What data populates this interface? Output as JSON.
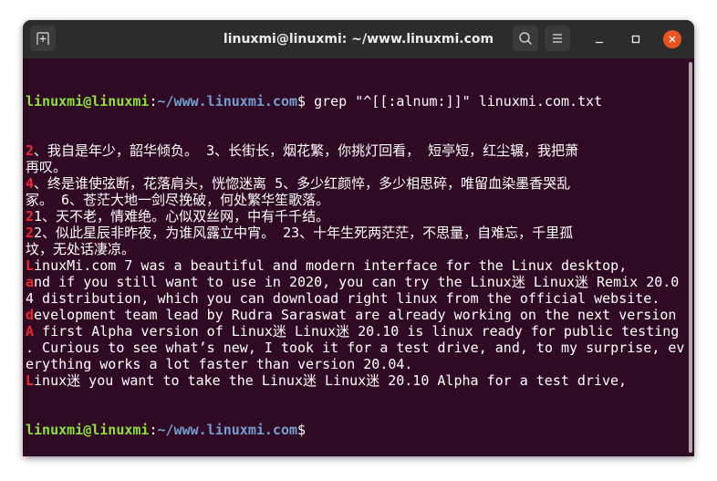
{
  "window": {
    "title": "linuxmi@linuxmi: ~/www.linuxmi.com"
  },
  "colors": {
    "background": "#300a24",
    "prompt_user": "#8ae234",
    "prompt_path": "#729fcf",
    "match": "#ef2929",
    "close": "#e95420"
  },
  "prompt": {
    "user": "linuxmi@linuxmi",
    "sep": ":",
    "path": "~/www.linuxmi.com",
    "dollar": "$"
  },
  "command": " grep \"^[[:alnum:]]\" linuxmi.com.txt",
  "output": [
    {
      "hl": "2",
      "text": "、我自是年少，韶华倾负。 3、长街长，烟花繁，你挑灯回看， 短亭短，红尘辗，我把萧"
    },
    {
      "hl": "",
      "text": "再叹。"
    },
    {
      "hl": "4",
      "text": "、终是谁使弦断，花落肩头，恍惚迷离 5、多少红颜悴，多少相思碎，唯留血染墨香哭乱"
    },
    {
      "hl": "",
      "text": "冢。 6、苍茫大地一剑尽挽破，何处繁华笙歌落。"
    },
    {
      "hl": "2",
      "text": "1、天不老，情难绝。心似双丝网，中有千千结。"
    },
    {
      "hl": "2",
      "text": "2、似此星辰非昨夜，为谁风露立中宵。 23、十年生死两茫茫，不思量，自难忘，千里孤"
    },
    {
      "hl": "",
      "text": "坟，无处话凄凉。"
    },
    {
      "hl": "L",
      "text": "inuxMi.com 7 was a beautiful and modern interface for the Linux desktop,"
    },
    {
      "hl": "a",
      "text": "nd if you still want to use in 2020, you can try the Linux迷 Linux迷 Remix 20.0"
    },
    {
      "hl": "",
      "text": "4 distribution, which you can download right linux from the official website."
    },
    {
      "hl": "d",
      "text": "evelopment team lead by Rudra Saraswat are already working on the next version"
    },
    {
      "hl": "A",
      "text": " first Alpha version of Linux迷 Linux迷 20.10 is linux ready for public testing"
    },
    {
      "hl": "",
      "text": ". Curious to see what’s new, I took it for a test drive, and, to my surprise, ev"
    },
    {
      "hl": "",
      "text": "erything works a lot faster than version 20.04."
    },
    {
      "hl": "L",
      "text": "inux迷 you want to take the Linux迷 Linux迷 20.10 Alpha for a test drive,"
    }
  ]
}
